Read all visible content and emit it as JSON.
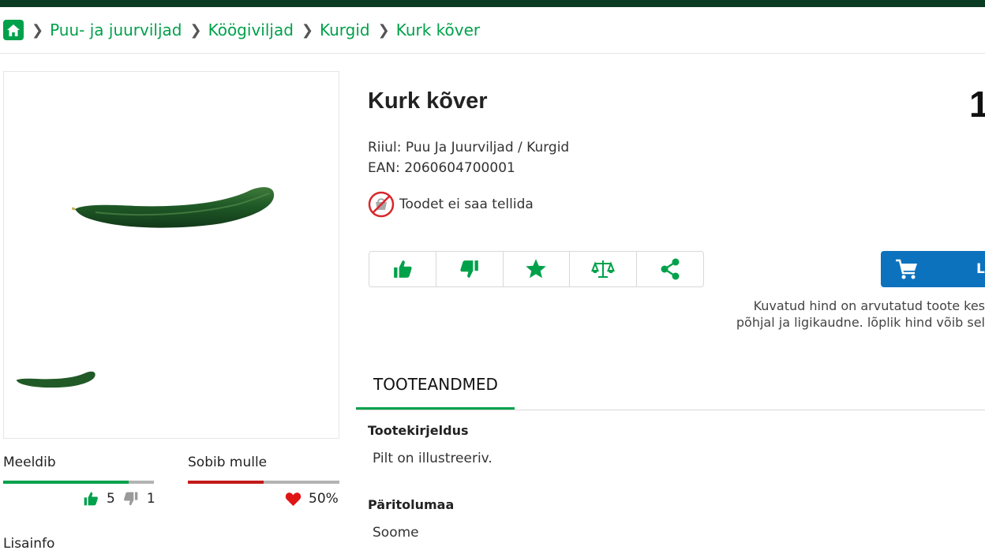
{
  "breadcrumb": {
    "items": [
      "Puu- ja juurviljad",
      "Köögiviljad",
      "Kurgid",
      "Kurk kõver"
    ]
  },
  "product": {
    "title": "Kurk kõver",
    "price_partial": "1",
    "shelf": "Riiul: Puu Ja Juurviljad / Kurgid",
    "ean": "EAN: 2060604700001",
    "unavailable": "Toodet ei saa tellida"
  },
  "actions": [
    "thumbs-up-icon",
    "thumbs-down-icon",
    "star-icon",
    "scale-icon",
    "share-icon"
  ],
  "cart": {
    "label": "Li"
  },
  "disclaimer": {
    "line1": "Kuvatud hind on arvutatud toote kes",
    "line2": "põhjal ja ligikaudne. lõplik hind võib sel"
  },
  "tabs": {
    "active": "TOOTEANDMED"
  },
  "details": {
    "desc_label": "Tootekirjeldus",
    "desc_value": "Pilt on illustreeriv.",
    "origin_label": "Päritolumaa",
    "origin_value": "Soome"
  },
  "ratings": {
    "likes_label": "Meeldib",
    "likes_fraction": 0.83,
    "up_count": "5",
    "down_count": "1",
    "suits_label": "Sobib mulle",
    "suits_fraction": 0.5,
    "suits_percent": "50%"
  },
  "lisainfo": "Lisainfo",
  "colors": {
    "brand_green": "#00a14b",
    "dark_green": "#0b3b22",
    "cart_blue": "#0d72bd",
    "red": "#c41a1a"
  }
}
